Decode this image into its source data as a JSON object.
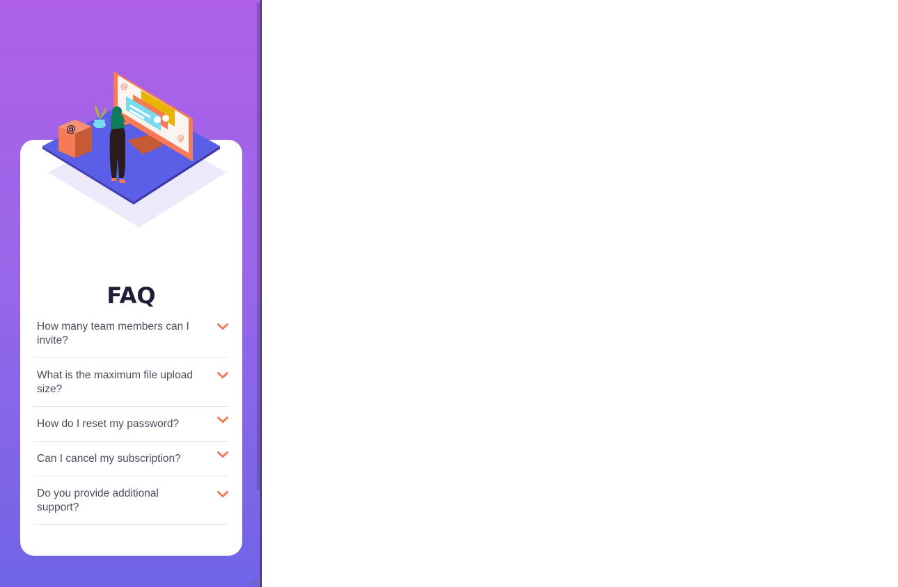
{
  "faq": {
    "title": "FAQ",
    "items": [
      {
        "question": "How many team members can I invite?"
      },
      {
        "question": "What is the maximum file upload size?"
      },
      {
        "question": "How do I reset my password?"
      },
      {
        "question": "Can I cancel my subscription?"
      },
      {
        "question": "Do you provide additional support?"
      }
    ],
    "chevron_icon": "chevron-down-icon"
  },
  "colors": {
    "gradient_top": "#ad5fe8",
    "gradient_bottom": "#7064e6",
    "accent": "#f47b56",
    "title": "#1e1f36",
    "question": "#4a4b5e",
    "divider": "#e2e3ec"
  }
}
